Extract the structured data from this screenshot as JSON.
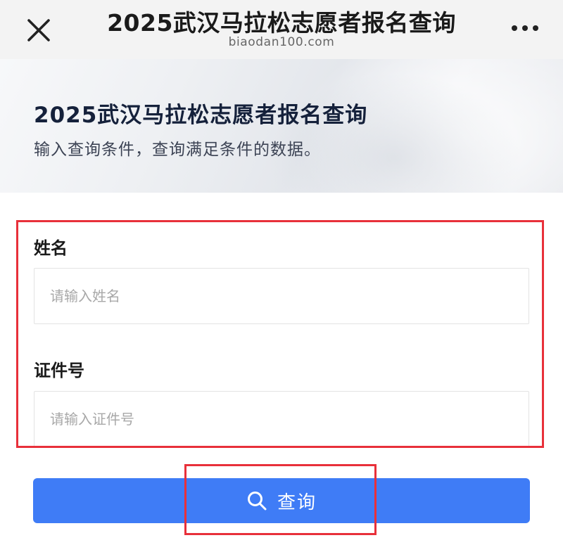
{
  "nav": {
    "title": "2025武汉马拉松志愿者报名查询",
    "subtitle": "biaodan100.com",
    "close_icon": "close-icon",
    "more_icon": "more-icon"
  },
  "header": {
    "title": "2025武汉马拉松志愿者报名查询",
    "description": "输入查询条件，查询满足条件的数据。"
  },
  "form": {
    "name_label": "姓名",
    "name_placeholder": "请输入姓名",
    "id_label": "证件号",
    "id_placeholder": "请输入证件号"
  },
  "query_button": {
    "label": "查询",
    "icon": "search-icon"
  },
  "colors": {
    "accent": "#3f7cf6",
    "annotation": "#e8303a",
    "title_text": "#15213b"
  }
}
